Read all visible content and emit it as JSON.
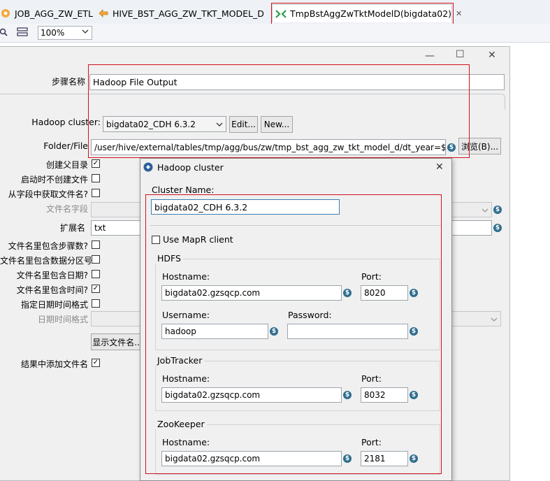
{
  "tabs": [
    {
      "label": "JOB_AGG_ZW_ETL",
      "icon": "job-icon"
    },
    {
      "label": "HIVE_BST_AGG_ZW_TKT_MODEL_D",
      "icon": "transformation-icon"
    },
    {
      "label": "TmpBstAggZwTktModelD(bigdata02)",
      "icon": "transformation-icon",
      "active": true
    }
  ],
  "toolbar": {
    "zoom": "100%"
  },
  "step": {
    "name_label": "步骤名称",
    "name_value": "Hadoop File Output",
    "cluster_label": "Hadoop cluster:",
    "cluster_value": "bigdata02_CDH 6.3.2",
    "edit_button": "Edit...",
    "new_button": "New...",
    "folder_label": "Folder/File",
    "folder_value": "/user/hive/external/tables/tmp/agg/bus/zw/tmp_bst_agg_zw_tkt_model_d/dt_year=${D",
    "browse_button": "浏览(B)...",
    "options": [
      {
        "label": "创建父目录",
        "checked": true
      },
      {
        "label": "启动时不创建文件",
        "checked": false
      },
      {
        "label": "从字段中获取文件名?",
        "checked": false
      }
    ],
    "filename_field_label": "文件名字段",
    "extension_label": "扩展名",
    "extension_value": "txt",
    "options2": [
      {
        "label": "文件名里包含步骤数?",
        "checked": false
      },
      {
        "label": "文件名里包含数据分区号?",
        "checked": false
      },
      {
        "label": "文件名里包含日期?",
        "checked": false
      },
      {
        "label": "文件名里包含时间?",
        "checked": true
      },
      {
        "label": "指定日期时间格式",
        "checked": false
      }
    ],
    "date_format_label": "日期时间格式",
    "show_filename_button": "显示文件名...",
    "add_to_result_label": "结果中添加文件名",
    "add_to_result_checked": true
  },
  "cluster_dialog": {
    "title": "Hadoop cluster",
    "cluster_name_label": "Cluster Name:",
    "cluster_name_value": "bigdata02_CDH 6.3.2",
    "mapr_label": "Use MapR client",
    "mapr_checked": false,
    "hdfs": {
      "title": "HDFS",
      "hostname_label": "Hostname:",
      "hostname_value": "bigdata02.gzsqcp.com",
      "port_label": "Port:",
      "port_value": "8020",
      "username_label": "Username:",
      "username_value": "hadoop",
      "password_label": "Password:",
      "password_value": ""
    },
    "jobtracker": {
      "title": "JobTracker",
      "hostname_label": "Hostname:",
      "hostname_value": "bigdata02.gzsqcp.com",
      "port_label": "Port:",
      "port_value": "8032"
    },
    "zookeeper": {
      "title": "ZooKeeper",
      "hostname_label": "Hostname:",
      "hostname_value": "bigdata02.gzsqcp.com",
      "port_label": "Port:",
      "port_value": "2181"
    }
  },
  "colors": {
    "highlight": "#d0121b",
    "variable_icon": "#2e6e8e",
    "input_focus": "#3c7fb1"
  }
}
